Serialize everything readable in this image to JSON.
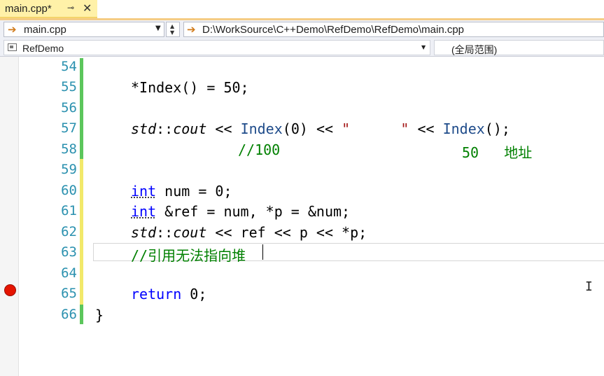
{
  "tab": {
    "title": "main.cpp*",
    "pin_glyph": "⊸",
    "close_glyph": "✕"
  },
  "nav": {
    "file_dropdown": "main.cpp",
    "path_dropdown": "D:\\WorkSource\\C++Demo\\RefDemo\\RefDemo\\main.cpp",
    "arrow_icon": "arrow-right-icon"
  },
  "scope": {
    "project_dropdown": "RefDemo",
    "scope_dropdown": "(全局范围)"
  },
  "editor": {
    "line_numbers": [
      "54",
      "55",
      "56",
      "57",
      "58",
      "59",
      "60",
      "61",
      "62",
      "63",
      "64",
      "65",
      "66"
    ],
    "breakpoint_line": "65",
    "lines": {
      "l55": "*Index() = 50;",
      "l57": {
        "a": "std",
        "b": "::",
        "c": "cout",
        "d": " << ",
        "e": "Index",
        "f": "(0) << ",
        "g": "\"      \"",
        "h": " << ",
        "i": "Index",
        "j": "();"
      },
      "l58": {
        "a": "//100",
        "b": "50   地址"
      },
      "l60": {
        "a": "int",
        "b": " num = 0;"
      },
      "l61": {
        "a": "int",
        "b": " &ref = num, *p = &num;"
      },
      "l62": {
        "a": "std",
        "b": "::",
        "c": "cout",
        "d": " << ref << p << *p;"
      },
      "l63": "//引用无法指向堆",
      "l65": {
        "a": "return",
        "b": " 0;"
      },
      "l66": "}"
    }
  },
  "colors": {
    "tab_bg": "#fff1a8",
    "line_number": "#2b91af",
    "keyword": "#0000ff",
    "comment": "#008000",
    "saved_change": "#5cc65c",
    "unsaved_change": "#f2e96a",
    "breakpoint": "#e51400"
  }
}
